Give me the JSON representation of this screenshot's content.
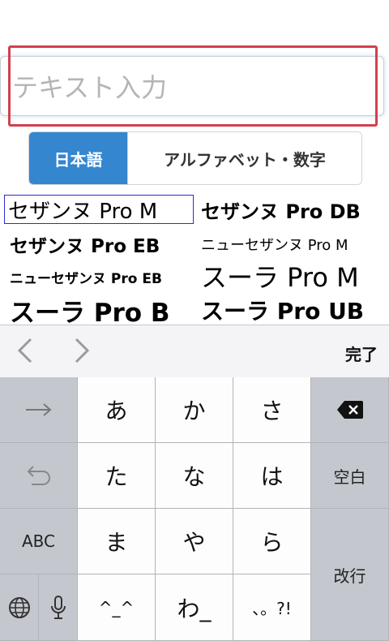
{
  "input": {
    "placeholder": "テキスト入力",
    "value": ""
  },
  "segments": [
    {
      "label": "日本語",
      "active": true
    },
    {
      "label": "アルファベット・数字",
      "active": false
    }
  ],
  "fonts": [
    {
      "label": "セザンヌ Pro M",
      "selected": true
    },
    {
      "label": "セザンヌ Pro DB",
      "selected": false
    },
    {
      "label": "セザンヌ Pro EB",
      "selected": false
    },
    {
      "label": "ニューセザンヌ Pro M",
      "selected": false
    },
    {
      "label": "ニューセザンヌ Pro EB",
      "selected": false
    },
    {
      "label": "スーラ Pro M",
      "selected": false
    },
    {
      "label": "スーラ Pro B",
      "selected": false
    },
    {
      "label": "スーラ Pro UB",
      "selected": false
    }
  ],
  "accessory": {
    "done_label": "完了"
  },
  "keyboard": {
    "row1": [
      "あ",
      "か",
      "さ"
    ],
    "row2": [
      "た",
      "な",
      "は"
    ],
    "row3": [
      "ま",
      "や",
      "ら"
    ],
    "row4": [
      "^_^",
      "わ_",
      "、。?!"
    ],
    "space_label": "空白",
    "return_label": "改行",
    "abc_label": "ABC"
  },
  "colors": {
    "accent": "#3486cf",
    "highlight": "#d2404f",
    "selection": "#2b2bd8"
  }
}
